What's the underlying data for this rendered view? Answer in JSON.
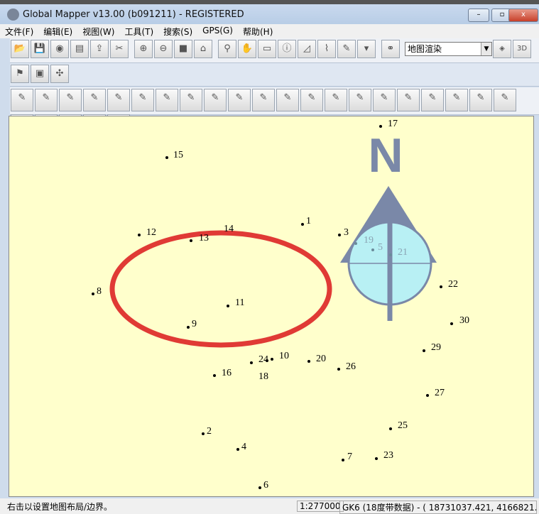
{
  "window": {
    "title": "Global Mapper v13.00 (b091211) - REGISTERED",
    "minimize": "–",
    "maximize": "▫",
    "close": "x"
  },
  "menu": [
    "文件(F)",
    "编辑(E)",
    "视图(W)",
    "工具(T)",
    "搜索(S)",
    "GPS(G)",
    "帮助(H)"
  ],
  "toolbar": {
    "render_select": "地图渲染",
    "icons": [
      "open-icon",
      "save-icon",
      "globe-icon",
      "layout-icon",
      "export-icon",
      "tools-icon",
      "zoom-in-icon",
      "zoom-out-icon",
      "full-view-icon",
      "home-icon",
      "zoom-tool-icon",
      "pan-icon",
      "measure-icon",
      "info-icon",
      "profile-icon",
      "tower-icon",
      "digitize-icon",
      "dropdown-icon",
      "binoculars-icon",
      "shader-icon",
      "3d-view-icon"
    ]
  },
  "map": {
    "north_label": "N",
    "points": [
      "17",
      "15",
      "12",
      "13",
      "14",
      "1",
      "3",
      "19",
      "5",
      "21",
      "8",
      "11",
      "9",
      "22",
      "30",
      "29",
      "10",
      "24",
      "18",
      "20",
      "26",
      "16",
      "27",
      "25",
      "2",
      "4",
      "7",
      "23",
      "6"
    ],
    "colors": {
      "background": "#ffffcc",
      "ellipse": "#e03a35",
      "arrow": "#7a88a8",
      "circle": "#b8f0f4"
    }
  },
  "status": {
    "message": "右击以设置地图布局/边界。",
    "scale": "1:277000",
    "projection": "GK6 (18度带数据) - ( 18731037.421, 4166821."
  }
}
